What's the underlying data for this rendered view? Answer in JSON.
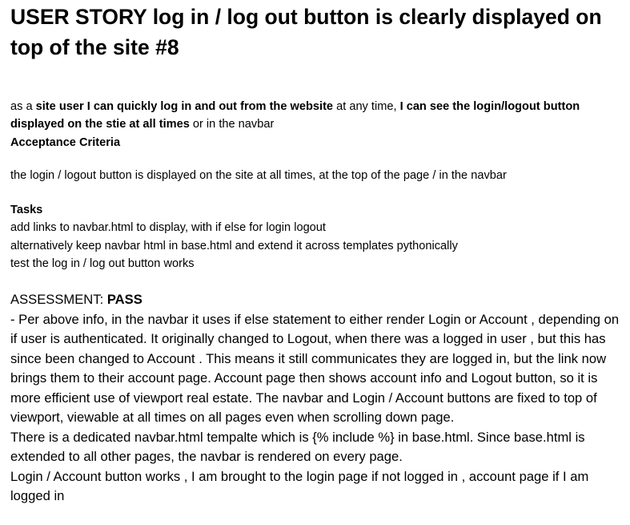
{
  "title": "USER STORY log in / log out button is clearly displayed on top of the site #8",
  "story": {
    "part1": "as a ",
    "part2": "site user I can quickly log in and out from the website",
    "part3": " at any time, ",
    "part4": "I can see the login/logout button displayed on the stie at all times",
    "part5": " or in the navbar"
  },
  "acceptance_criteria": {
    "heading": "Acceptance Criteria",
    "text": "the login / logout button is displayed on the site at all times, at the top of the page / in the navbar"
  },
  "tasks": {
    "heading": "Tasks",
    "items": [
      "add links to navbar.html to display, with if else for login logout",
      "alternatively keep navbar html in base.html and extend it across templates pythonically",
      "test the log in / log out button works"
    ]
  },
  "assessment": {
    "label": "ASSESSMENT: ",
    "result": "PASS",
    "paragraphs": [
      " - Per above info, in the navbar it uses if else statement to either render Login or Account , depending on if user is authenticated. It originally changed to Logout, when there was a logged in user , but this has since been changed to Account . This means it still communicates they are logged in, but the link now brings them to their account page. Account page then shows account info and Logout button, so it is more efficient use of viewport real estate. The navbar and Login / Account buttons are fixed to top of viewport, viewable at all times on all pages even when scrolling down page.",
      "There is a dedicated navbar.html tempalte which is {% include %} in base.html. Since base.html is extended to all other pages, the navbar is rendered on every page.",
      "Login / Account button works , I am brought to the login page if not logged in , account page if I am logged in"
    ]
  }
}
